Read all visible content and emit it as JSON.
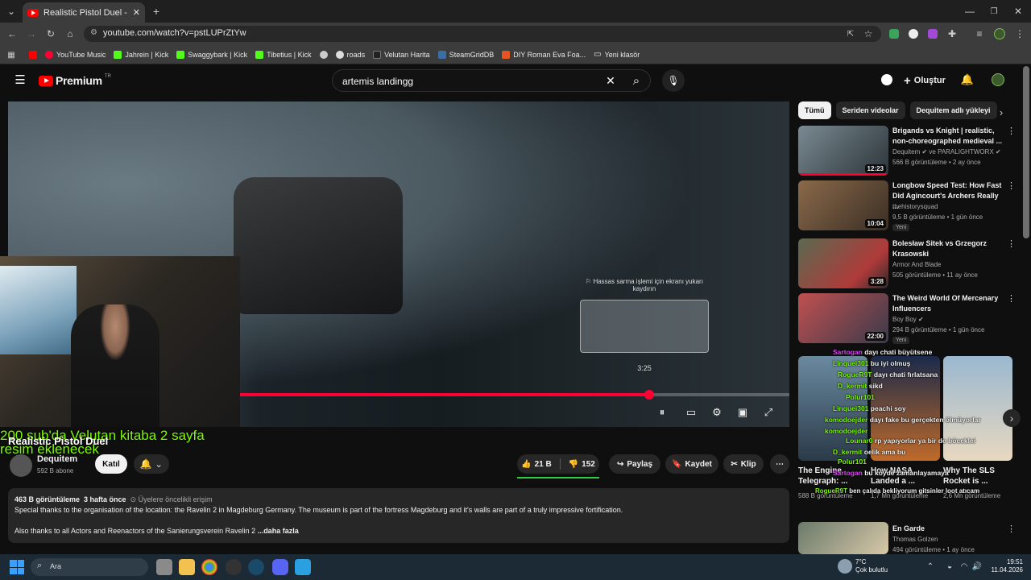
{
  "browser": {
    "tab_title": "Realistic Pistol Duel - YouTu",
    "url": "youtube.com/watch?v=pstLUPrZtYw",
    "bookmarks": [
      "YouTube Music",
      "Jahrein | Kick",
      "Swaggybark | Kick",
      "Tibetius | Kick",
      "roads",
      "Velutan Harita",
      "SteamGridDB",
      "DIY Roman Eva Foa...",
      "Yeni klasör"
    ]
  },
  "yt": {
    "logo": "Premium",
    "logo_region": "TR",
    "search_value": "artemis landingg",
    "create_label": "Oluştur"
  },
  "player": {
    "seek_tip": "⚐ Hassas sarma işlemi için ekranı yukarı kaydırın",
    "preview_time": "3:25",
    "progress_fraction": 0.745,
    "overlay_text": "200 sub'da Velutan kitaba 2 sayfa resim eklenecek"
  },
  "video": {
    "title": "Realistic Pistol Duel",
    "channel": "Dequitem",
    "subs": "592 B abone",
    "join_label": "Katıl",
    "likes": "21 B",
    "dislikes": "152",
    "share_label": "Paylaş",
    "save_label": "Kaydet",
    "clip_label": "Klip",
    "views": "463 B görüntüleme",
    "age": "3 hafta önce",
    "early_access": "Üyelere öncelikli erişim",
    "desc_line1": "Special thanks to the organisation of the location: the Ravelin 2 in Magdeburg Germany. The museum is part of the fortress Magdeburg and it's walls are part of a truly impressive fortification.",
    "desc_line2": "Also thanks to all Actors and Reenactors of the Sanierungsverein Ravelin 2",
    "more_label": "...daha fazla"
  },
  "sidebar": {
    "chips": [
      "Tümü",
      "Seriden videolar",
      "Dequitem adlı yükleyi"
    ],
    "recs": [
      {
        "title": "Brigands vs Knight | realistic, non-choreographed medieval ...",
        "channel": "Dequitem",
        "channel2": "ve PARALIGHTWORX",
        "meta": "566 B görüntüleme • 2 ay önce",
        "duration": "12:23",
        "badge": ""
      },
      {
        "title": "Longbow Speed Test: How Fast Did Agincourt's Archers Really ...",
        "channel": "thehistorysquad",
        "channel2": "",
        "meta": "9,5 B görüntüleme • 1 gün önce",
        "duration": "10:04",
        "badge": "Yeni"
      },
      {
        "title": "Bolesław Sitek vs Grzegorz Krasowski",
        "channel": "Armor And Blade",
        "channel2": "",
        "meta": "505 görüntüleme • 11 ay önce",
        "duration": "3:28",
        "badge": ""
      },
      {
        "title": "The Weird World Of Mercenary Influencers",
        "channel": "Boy Boy",
        "channel2": "",
        "meta": "294 B görüntüleme • 1 gün önce",
        "duration": "22:00",
        "badge": "Yeni"
      }
    ],
    "shorts": [
      {
        "title": "The Engine Telegraph: ...",
        "meta": "588 B görüntüleme"
      },
      {
        "title": "How NASA Landed a ...",
        "meta": "1,7 Mn görüntüleme"
      },
      {
        "title": "Why The SLS Rocket is ...",
        "meta": "2,6 Mn görüntüleme"
      }
    ],
    "last_rec": {
      "title": "En Garde",
      "channel": "Thomas Golzen",
      "meta": "494 görüntüleme • 1 ay önce"
    }
  },
  "chat": [
    {
      "user": "Sartogan",
      "msg": "dayı chati büyütsene",
      "color": "#e040fb"
    },
    {
      "user": "Linquei301",
      "msg": "bu iyi olmuş",
      "color": "#7cfc00"
    },
    {
      "user": "RogueR9T",
      "msg": "dayı chati fırlatsana",
      "color": "#7cfc00"
    },
    {
      "user": "D_kermit",
      "msg": "sikd",
      "color": "#7cfc00"
    },
    {
      "user": "Polur101",
      "msg": "",
      "color": "#7cfc00"
    },
    {
      "user": "Linquei301",
      "msg": "peachi soy",
      "color": "#7cfc00"
    },
    {
      "user": "komodoejder",
      "msg": "dayı fake bu gerçekten ölmüyorlar",
      "color": "#7cfc00"
    },
    {
      "user": "Lounar0",
      "msg": "rp yapıyorlar ya bir de böceklei",
      "color": "#7cfc00"
    },
    {
      "user": "komodoejder",
      "msg": "",
      "color": "#7cfc00"
    },
    {
      "user": "D_kermit",
      "msg": "oelik ama bu",
      "color": "#7cfc00"
    },
    {
      "user": "Polur101",
      "msg": "",
      "color": "#7cfc00"
    },
    {
      "user": "Sartogan",
      "msg": "bu köyde zamanlayamaya",
      "color": "#e040fb"
    },
    {
      "user": "RogueR9T",
      "msg": "ben çalıda bekliyorum gitsinler loot atıcam",
      "color": "#7cfc00"
    }
  ],
  "taskbar": {
    "search_placeholder": "Ara",
    "weather_temp": "7°C",
    "weather_desc": "Çok bulutlu",
    "time": "19:51",
    "date": "11.04.2026"
  }
}
